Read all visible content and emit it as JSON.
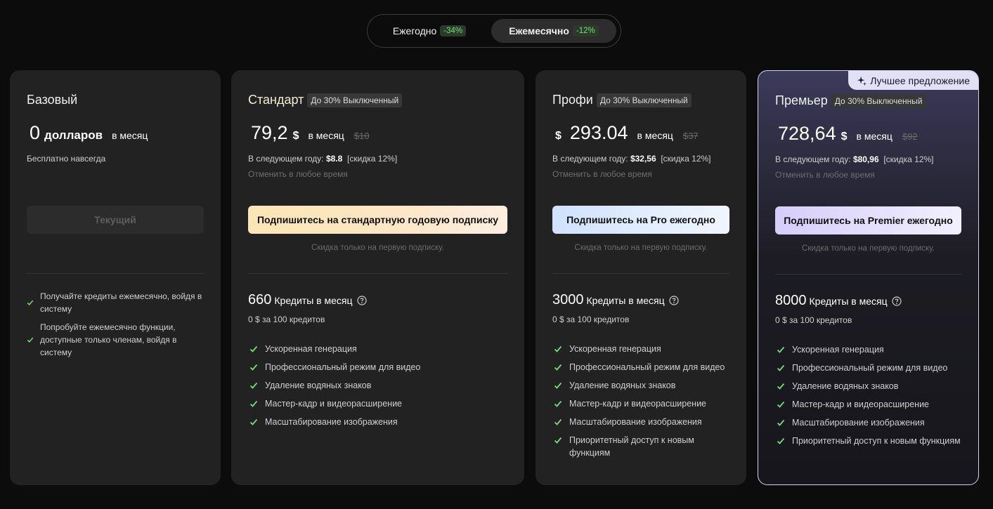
{
  "billing_toggle": {
    "yearly": {
      "label": "Ежегодно",
      "badge": "-34%"
    },
    "monthly": {
      "label": "Ежемесячно",
      "badge": "-12%",
      "selected": true
    }
  },
  "colors": {
    "check": "#6fe06f",
    "background": "#0c0c0c",
    "card": "#222222"
  },
  "plans": [
    {
      "name": "Базовый",
      "price": "0",
      "currency": "долларов",
      "per": "в месяц",
      "subtitle": "Бесплатно навсегда",
      "cta": "Текущий",
      "features": [
        "Получайте кредиты ежемесячно, войдя в систему",
        "Попробуйте ежемесячно функции, доступные только членам, войдя в систему"
      ]
    },
    {
      "name": "Стандарт",
      "discount_tag": "До 30% Выключенный",
      "price": "79,2",
      "currency": "$",
      "per": "в месяц",
      "old_price": "$10",
      "next_year_label": "В следующем году:",
      "next_year_price": "$8.8",
      "next_year_discount": "[скидка 12%]",
      "cancel": "Отменить в любое время",
      "cta": "Подпишитесь на стандартную годовую подписку",
      "cta_note": "Скидка только на первую подписку.",
      "credits": "660",
      "credits_unit": "Кредиты в месяц",
      "credit_price": "0 $ за 100 кредитов",
      "features": [
        "Ускоренная генерация",
        "Профессиональный режим для видео",
        "Удаление водяных знаков",
        "Мастер-кадр и видеорасширение",
        "Масштабирование изображения"
      ]
    },
    {
      "name": "Профи",
      "discount_tag": "До 30% Выключенный",
      "price": "293.04",
      "currency": "$",
      "per": "в месяц",
      "old_price": "$37",
      "next_year_label": "В следующем году:",
      "next_year_price": "$32,56",
      "next_year_discount": "[скидка 12%]",
      "cancel": "Отменить в любое время",
      "cta": "Подпишитесь на Pro ежегодно",
      "cta_note": "Скидка только на первую подписку.",
      "credits": "3000",
      "credits_unit": "Кредиты в месяц",
      "credit_price": "0 $ за 100 кредитов",
      "features": [
        "Ускоренная генерация",
        "Профессиональный режим для видео",
        "Удаление водяных знаков",
        "Мастер-кадр и видеорасширение",
        "Масштабирование изображения",
        "Приоритетный доступ к новым функциям"
      ]
    },
    {
      "name": "Премьер",
      "best_badge": "Лучшее предложение",
      "discount_tag": "До 30% Выключенный",
      "price": "728,64",
      "currency": "$",
      "per": "в месяц",
      "old_price": "$92",
      "next_year_label": "В следующем году:",
      "next_year_price": "$80,96",
      "next_year_discount": "[скидка 12%]",
      "cancel": "Отменить в любое время",
      "cta": "Подпишитесь на Premier ежегодно",
      "cta_note": "Скидка только на первую подписку.",
      "credits": "8000",
      "credits_unit": "Кредиты в месяц",
      "credit_price": "0 $ за 100 кредитов",
      "features": [
        "Ускоренная генерация",
        "Профессиональный режим для видео",
        "Удаление водяных знаков",
        "Мастер-кадр и видеорасширение",
        "Масштабирование изображения",
        "Приоритетный доступ к новым функциям"
      ]
    }
  ]
}
